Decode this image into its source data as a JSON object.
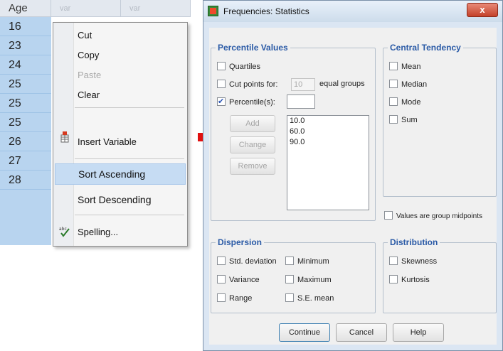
{
  "spreadsheet": {
    "headers": [
      "Age",
      "var",
      "var"
    ],
    "rows": [
      "16",
      "23",
      "24",
      "25",
      "25",
      "25",
      "26",
      "27",
      "28"
    ]
  },
  "context_menu": {
    "items": [
      {
        "label": "Cut",
        "enabled": true
      },
      {
        "label": "Copy",
        "enabled": true
      },
      {
        "label": "Paste",
        "enabled": false
      },
      {
        "label": "Clear",
        "enabled": true
      },
      {
        "label": "Insert Variable",
        "enabled": true,
        "icon": "insert-variable-icon"
      },
      {
        "label": "Sort Ascending",
        "enabled": true,
        "highlighted": true
      },
      {
        "label": "Sort Descending",
        "enabled": true
      },
      {
        "label": "Spelling...",
        "enabled": true,
        "icon": "spelling-icon"
      }
    ]
  },
  "dialog": {
    "title": "Frequencies: Statistics",
    "close_label": "x",
    "percentile_values": {
      "title": "Percentile Values",
      "quartiles": "Quartiles",
      "cut_points_for": "Cut points for:",
      "cut_points_value": "10",
      "equal_groups": "equal groups",
      "percentiles": "Percentile(s):",
      "percentiles_input": "",
      "add": "Add",
      "change": "Change",
      "remove": "Remove",
      "list": [
        "10.0",
        "60.0",
        "90.0"
      ]
    },
    "central_tendency": {
      "title": "Central Tendency",
      "mean": "Mean",
      "median": "Median",
      "mode": "Mode",
      "sum": "Sum"
    },
    "midpoints": "Values are group midpoints",
    "dispersion": {
      "title": "Dispersion",
      "std_deviation": "Std. deviation",
      "minimum": "Minimum",
      "variance": "Variance",
      "maximum": "Maximum",
      "range": "Range",
      "se_mean": "S.E. mean"
    },
    "distribution": {
      "title": "Distribution",
      "skewness": "Skewness",
      "kurtosis": "Kurtosis"
    },
    "buttons": {
      "continue": "Continue",
      "cancel": "Cancel",
      "help": "Help"
    }
  },
  "colors": {
    "selected_cell": "#b8d4ef",
    "menu_highlight": "#c6dcf3",
    "arrow": "#e01010",
    "group_title": "#2a5aa6"
  }
}
